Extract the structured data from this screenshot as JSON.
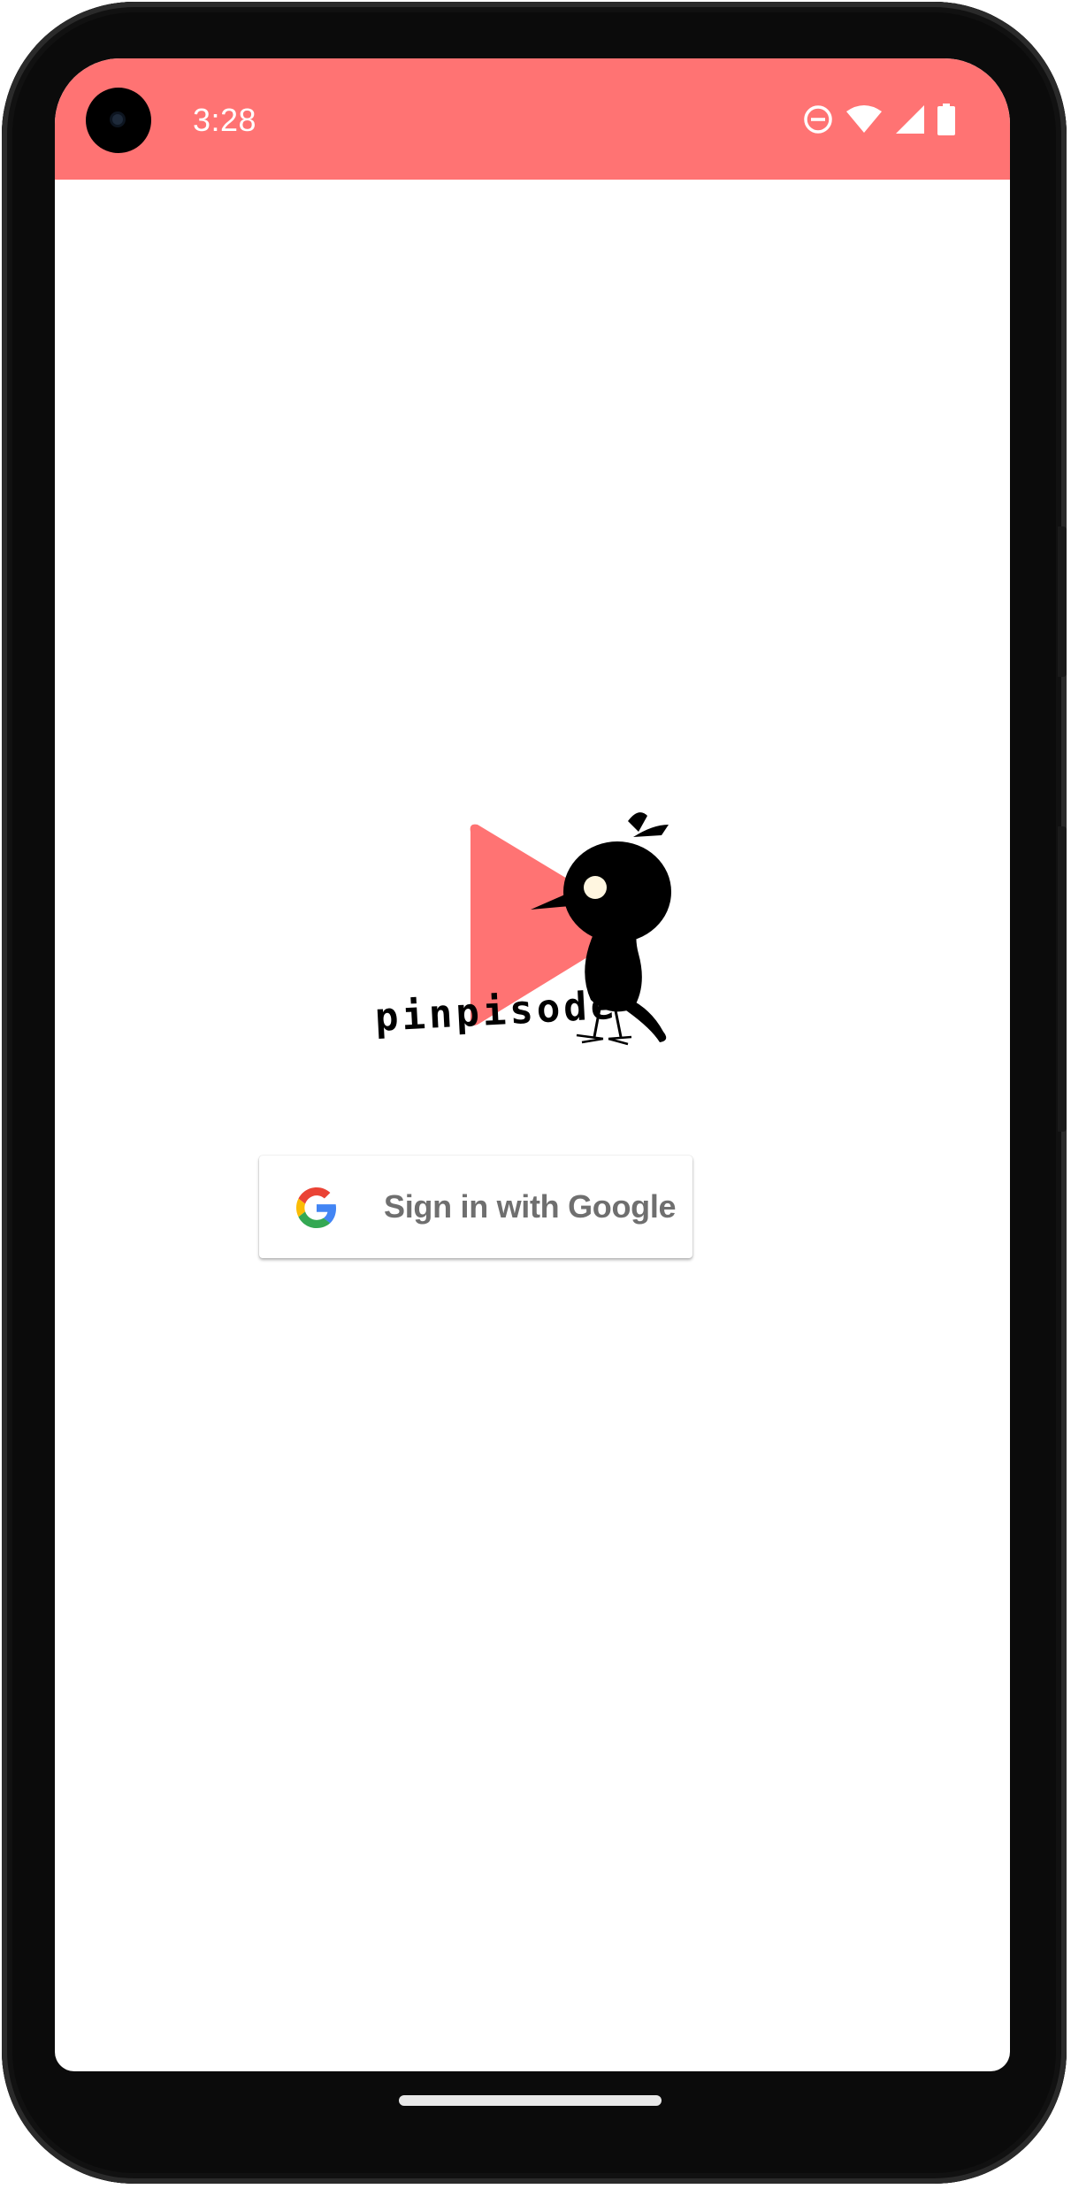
{
  "status_bar": {
    "time": "3:28",
    "background_color": "#ff7373",
    "icons": [
      "do-not-disturb-icon",
      "wifi-icon",
      "cellular-signal-icon",
      "battery-icon"
    ]
  },
  "app": {
    "name": "pinpisode",
    "brand_color": "#ff7373",
    "logo_icon": "play-triangle-bird-logo"
  },
  "sign_in": {
    "label": "Sign in with Google",
    "icon": "google-g-icon"
  },
  "navigation": {
    "handle": "home-gesture-pill"
  }
}
